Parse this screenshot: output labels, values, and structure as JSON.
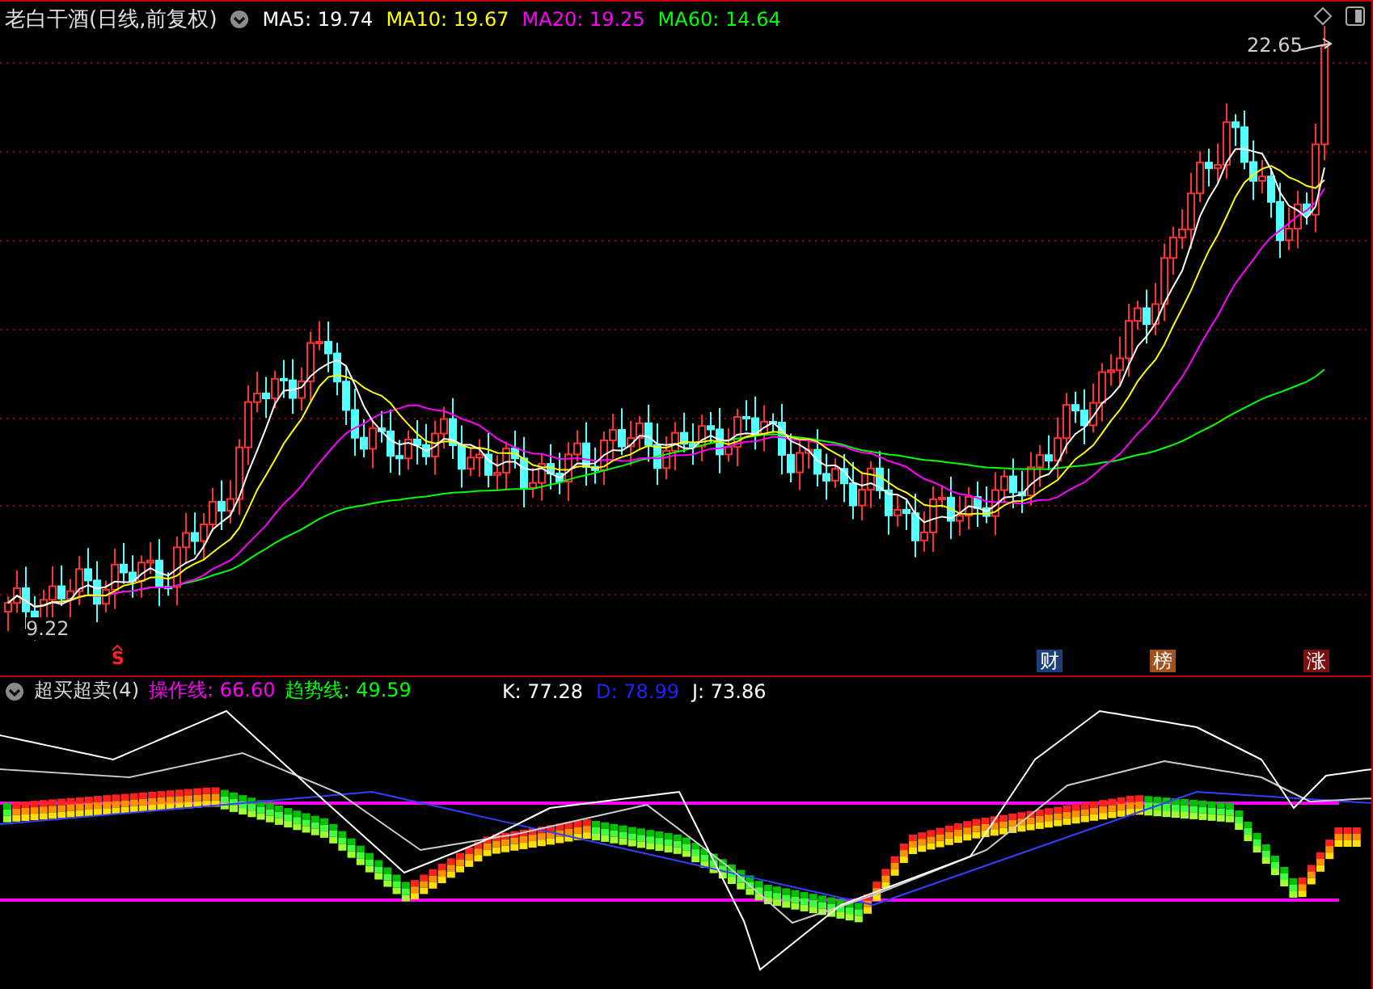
{
  "main_panel": {
    "title": "老白干酒(日线,前复权)",
    "indicators": [
      {
        "label": "MA5: 19.74",
        "color": "#ffffff"
      },
      {
        "label": "MA10: 19.67",
        "color": "#ffff00"
      },
      {
        "label": "MA20: 19.25",
        "color": "#ff00ff"
      },
      {
        "label": "MA60: 14.64",
        "color": "#00ff00"
      }
    ],
    "high_label": "22.65",
    "low_label": "9.22",
    "markers": [
      {
        "text": "S",
        "kind": "signal",
        "color": "#ff2020"
      },
      {
        "text": "财",
        "kind": "badge",
        "color": "#1c3f7a"
      },
      {
        "text": "榜",
        "kind": "badge",
        "color": "#a0521c"
      },
      {
        "text": "涨",
        "kind": "badge",
        "color": "#7a1010"
      }
    ]
  },
  "sub_panel": {
    "title": "超买超卖(4)",
    "lines": [
      {
        "label": "操作线: 66.60",
        "color": "#ff00ff"
      },
      {
        "label": "趋势线: 49.59",
        "color": "#00ff00"
      }
    ],
    "kdj": [
      {
        "label": "K: 77.28",
        "color": "#ffffff"
      },
      {
        "label": "D: 78.99",
        "color": "#2020ff"
      },
      {
        "label": "J: 73.86",
        "color": "#ffffff"
      }
    ]
  }
}
